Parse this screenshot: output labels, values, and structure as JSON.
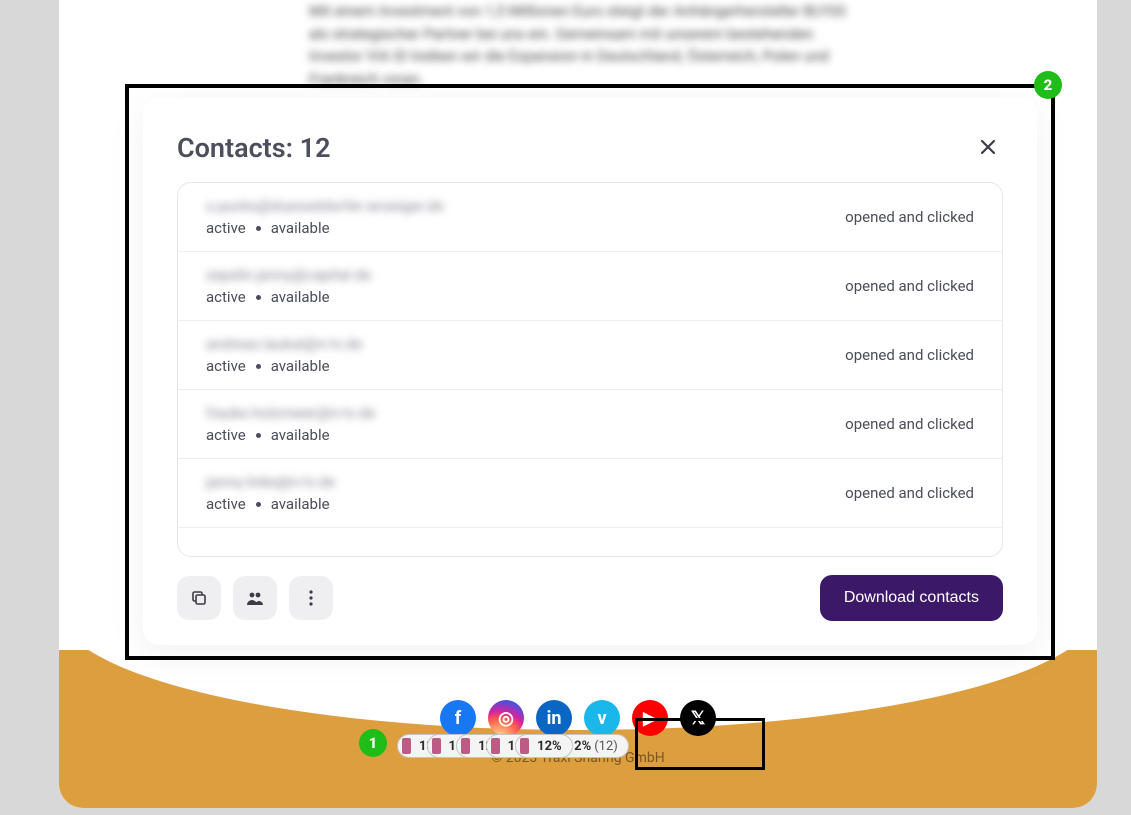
{
  "bg": {
    "paragraph": "Mit einem Investment von 1,5 Millionen Euro steigt der Anhängerhersteller BLYSS als strategischer Partner bei uns ein. Gemeinsam mit unserem bestehenden Investor VIA ID treiben wir die Expansion in Deutschland, Österreich, Polen und Frankreich voran.",
    "copyright": "© 2023 Traxi Sharing GmbH"
  },
  "modal": {
    "title": "Contacts: 12",
    "close_aria": "Close",
    "download_label": "Download contacts",
    "status_active": "active",
    "status_available": "available",
    "action_opened_clicked": "opened and clicked",
    "contacts": [
      {
        "email": "s.pucks@duesseldorfer-anzeiger.de"
      },
      {
        "email": "zepelin.jenny@capital.de"
      },
      {
        "email": "andreas.laukat@n-tv.de"
      },
      {
        "email": "frauke.holzmeier@n-tv.de"
      },
      {
        "email": "janna.linke@n-tv.de"
      }
    ]
  },
  "pills": [
    {
      "pct": "13%"
    },
    {
      "pct": "12%"
    },
    {
      "pct": "12%"
    },
    {
      "pct": "12%"
    },
    {
      "pct": "12%"
    },
    {
      "pct": "12%",
      "count": "(12)"
    }
  ],
  "badges": {
    "one": "1",
    "two": "2"
  }
}
